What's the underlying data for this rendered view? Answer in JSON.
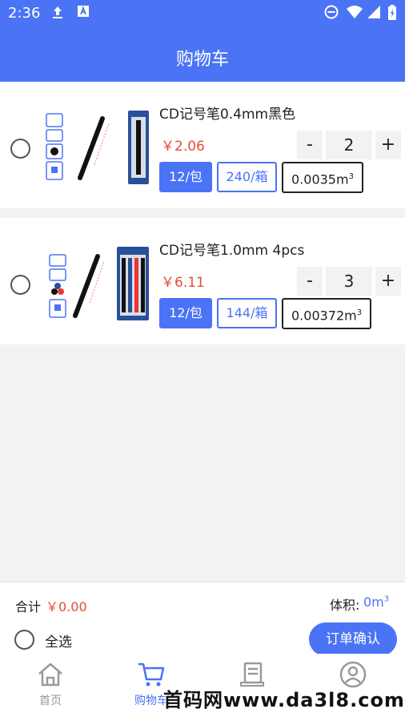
{
  "status_bar": {
    "time": "2:36"
  },
  "header": {
    "title": "购物车"
  },
  "cart": {
    "items": [
      {
        "name": "CD记号笔0.4mm黑色",
        "price": "￥2.06",
        "quantity": "2",
        "pack_tag": "12/包",
        "box_tag": "240/箱",
        "volume": "0.0035m",
        "volume_sup": "3"
      },
      {
        "name": "CD记号笔1.0mm 4pcs",
        "price": "￥6.11",
        "quantity": "3",
        "pack_tag": "12/包",
        "box_tag": "144/箱",
        "volume": "0.00372m",
        "volume_sup": "3"
      }
    ],
    "qty_minus": "-",
    "qty_plus": "+"
  },
  "footer": {
    "total_label": "合计",
    "total_value": "￥0.00",
    "volume_label": "体积:",
    "volume_value": "0m",
    "volume_sup": "3",
    "select_all": "全选",
    "checkout": "订单确认"
  },
  "tabbar": {
    "tabs": [
      {
        "label": "首页",
        "icon": "home-icon"
      },
      {
        "label": "购物车",
        "icon": "cart-icon"
      },
      {
        "label": "订单",
        "icon": "order-icon"
      },
      {
        "label": "我的",
        "icon": "profile-icon"
      }
    ],
    "active": 1
  },
  "watermark": "首码网www.da3l8.com",
  "colors": {
    "primary": "#4a73f5",
    "price": "#e84a3c"
  }
}
